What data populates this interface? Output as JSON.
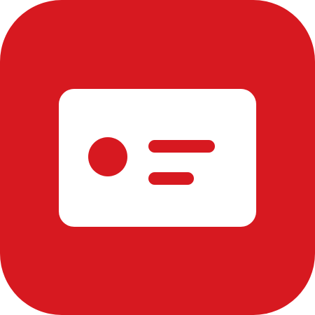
{
  "icon": {
    "name": "id-card-app-icon",
    "glyph": "id-card-icon",
    "colors": {
      "background": "#D71920",
      "card": "#FFFFFF",
      "accent": "#D71920"
    }
  }
}
